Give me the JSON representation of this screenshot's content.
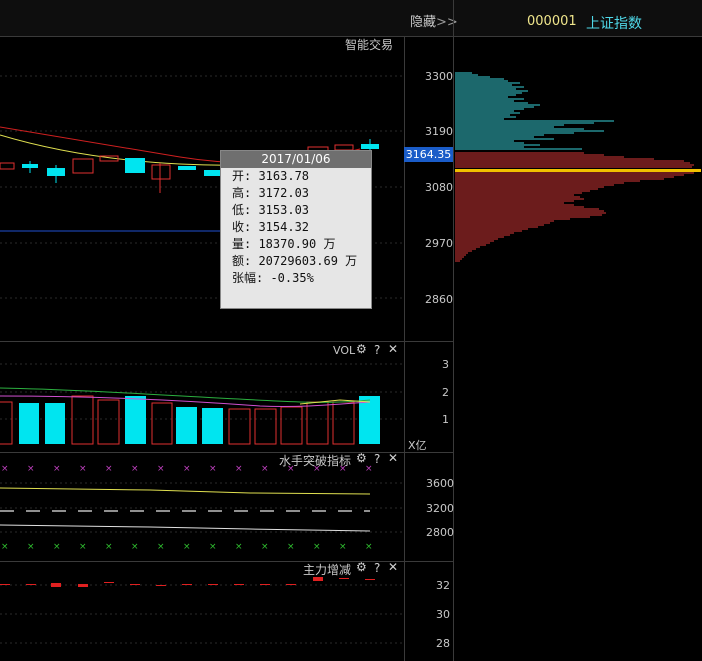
{
  "header": {
    "hide_label": "隐藏",
    "hide_arrows": ">>",
    "index_code": "000001",
    "index_name": "上证指数"
  },
  "main_chart": {
    "label": "智能交易",
    "price_axis": [
      "3300",
      "3190",
      "3080",
      "2970",
      "2860"
    ],
    "current_price": "3164.35"
  },
  "tooltip": {
    "date": "2017/01/06",
    "lines": [
      "开: 3163.78",
      "高: 3172.03",
      "低: 3153.03",
      "收: 3154.32",
      "量: 18370.90 万",
      "额: 20729603.69 万",
      "张幅: -0.35%"
    ]
  },
  "vol_panel": {
    "label": "VOL",
    "axis": [
      "3",
      "2",
      "1"
    ],
    "unit": "X亿"
  },
  "sailor_panel": {
    "label": "水手突破指标",
    "axis": [
      "3600",
      "3200",
      "2800"
    ]
  },
  "main_force_panel": {
    "label": "主力增减",
    "axis": [
      "32",
      "30",
      "28"
    ]
  },
  "icons": {
    "gear": "⚙",
    "help": "?",
    "close": "✕"
  },
  "colors": {
    "up": "#e03030",
    "down": "#00e5f0",
    "ma_red": "#d02020",
    "ma_yellow": "#e0e050",
    "current_price_bg": "#1a5cc8",
    "chip_yellow": "#f0c000"
  }
}
